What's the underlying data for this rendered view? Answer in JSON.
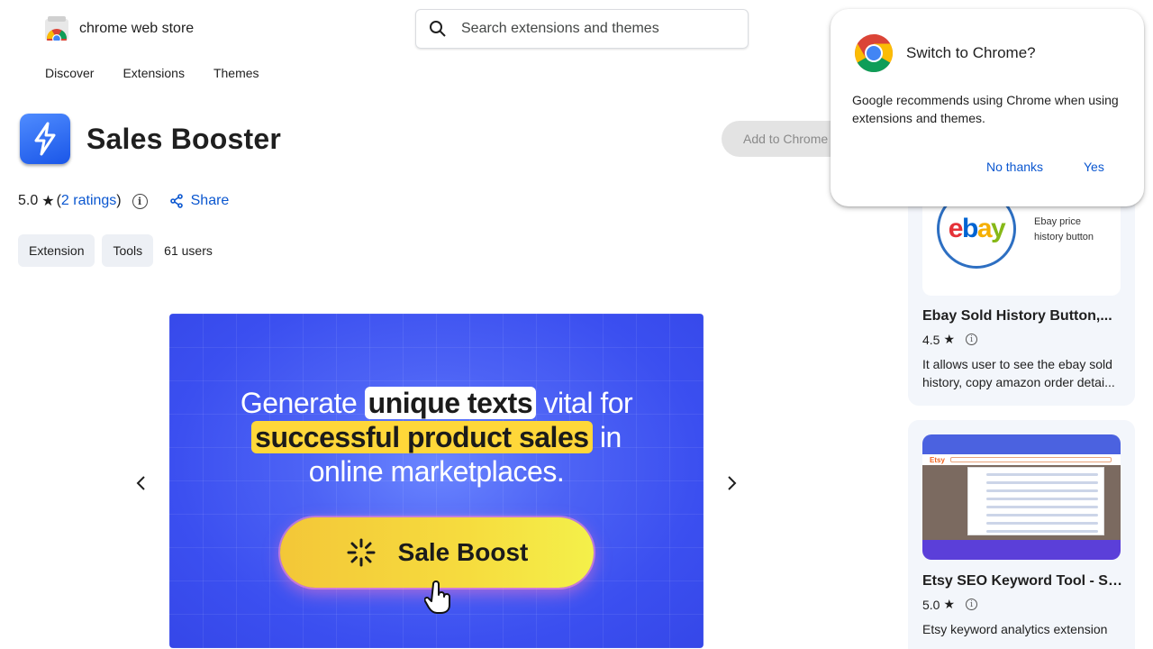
{
  "header": {
    "store_name": "chrome web store",
    "search_placeholder": "Search extensions and themes",
    "nav": [
      "Discover",
      "Extensions",
      "Themes"
    ]
  },
  "extension": {
    "title": "Sales Booster",
    "add_button": "Add to Chrome",
    "rating": "5.0",
    "ratings_link": "2 ratings",
    "share_label": "Share",
    "tags": [
      "Extension",
      "Tools"
    ],
    "users": "61 users",
    "icon": "lightning-bolt-icon"
  },
  "slide": {
    "line1_pre": "Generate",
    "line1_highlight": "unique texts",
    "line1_post": "vital for",
    "line2_highlight": "successful product sales",
    "line2_post": "in",
    "line3": "online marketplaces.",
    "button_label": "Sale Boost"
  },
  "related": [
    {
      "title": "Ebay Sold History Button,...",
      "rating": "4.5",
      "description": "It allows user to see the ebay sold history, copy amazon order detai...",
      "thumb_text": [
        "Ebay price",
        "history button"
      ]
    },
    {
      "title": "Etsy SEO Keyword Tool - Sa...",
      "rating": "5.0",
      "description": "Etsy keyword analytics extension",
      "thumb_brand": "Etsy"
    }
  ],
  "popup": {
    "title": "Switch to Chrome?",
    "body": "Google recommends using Chrome when using extensions and themes.",
    "no_label": "No thanks",
    "yes_label": "Yes"
  },
  "colors": {
    "link_blue": "#0b57d0",
    "slide_blue": "#3b4ff0",
    "highlight_yellow": "#ffd739"
  }
}
